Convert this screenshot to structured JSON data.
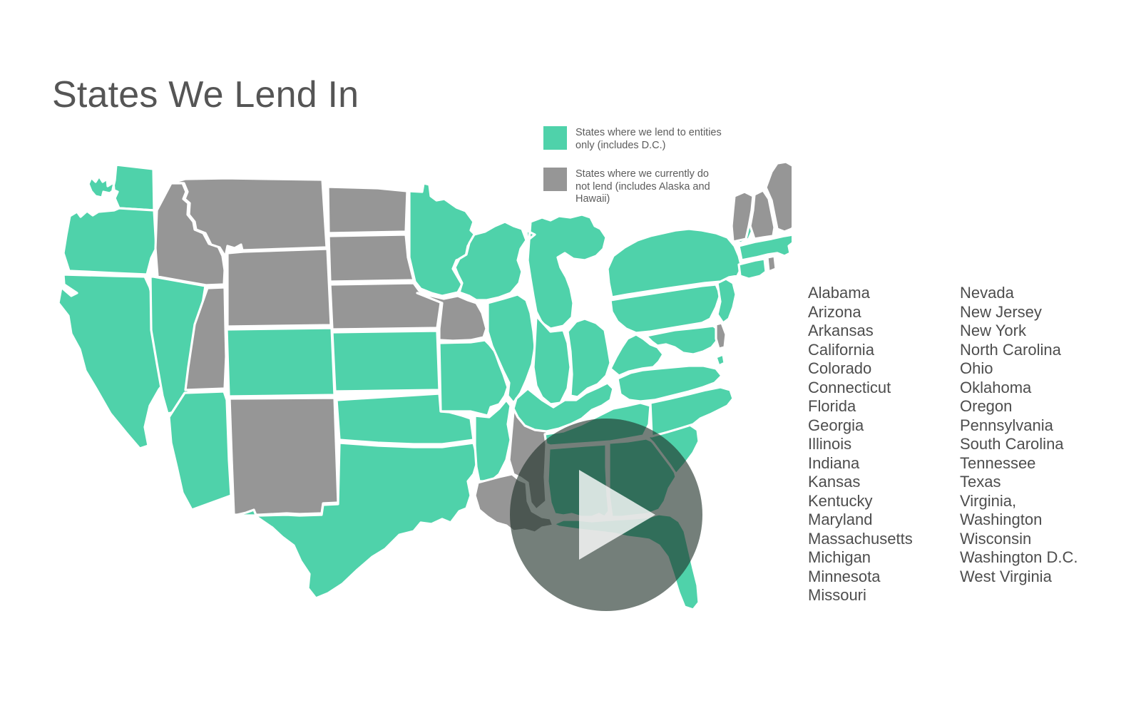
{
  "page": {
    "title": "States We Lend In",
    "background_color": "#ffffff",
    "text_color": "#4d4d4d"
  },
  "colors": {
    "lend_green": "#4FD2AA",
    "no_lend_gray": "#969696",
    "border_white": "#ffffff",
    "title_gray": "#555555",
    "overlay_dark": "rgba(30,48,40,0.62)",
    "overlay_triangle": "rgba(255,255,255,0.80)"
  },
  "legend": {
    "items": [
      {
        "swatch_color": "#4FD2AA",
        "label": "States where we lend to entities only (includes D.C.)",
        "icon": "green-square-swatch"
      },
      {
        "swatch_color": "#969696",
        "label": "States where we currently do not lend (includes Alaska and Hawaii)",
        "icon": "gray-square-swatch"
      }
    ]
  },
  "video": {
    "play_icon": "play-triangle-icon",
    "label": "Play video"
  },
  "state_list": {
    "column_1": [
      "Alabama",
      "Arizona",
      "Arkansas",
      "California",
      "Colorado",
      "Connecticut",
      "Florida",
      "Georgia",
      "Illinois",
      "Indiana",
      "Kansas",
      "Kentucky",
      "Maryland",
      "Massachusetts",
      "Michigan",
      "Minnesota",
      "Missouri"
    ],
    "column_2": [
      "Nevada",
      "New Jersey",
      "New York",
      "North Carolina",
      "Ohio",
      "Oklahoma",
      "Oregon",
      "Pennsylvania",
      "South Carolina",
      "Tennessee",
      "Texas",
      "Virginia,",
      "Washington",
      "Wisconsin",
      "Washington D.C.",
      "West Virginia"
    ]
  },
  "map_data": {
    "type": "choropleth",
    "region": "United States (contiguous)",
    "categories": {
      "lend": "States where we lend to entities only (includes D.C.)",
      "no_lend": "States where we currently do not lend (includes Alaska and Hawaii)"
    },
    "states": {
      "WA": "lend",
      "OR": "lend",
      "CA": "lend",
      "NV": "lend",
      "AZ": "lend",
      "ID": "no_lend",
      "MT": "no_lend",
      "WY": "no_lend",
      "UT": "no_lend",
      "CO": "lend",
      "NM": "no_lend",
      "ND": "no_lend",
      "SD": "no_lend",
      "NE": "no_lend",
      "KS": "lend",
      "OK": "lend",
      "TX": "lend",
      "MN": "lend",
      "IA": "no_lend",
      "MO": "lend",
      "AR": "lend",
      "LA": "no_lend",
      "WI": "lend",
      "IL": "lend",
      "MI": "lend",
      "IN": "lend",
      "OH": "lend",
      "KY": "lend",
      "TN": "lend",
      "MS": "no_lend",
      "AL": "lend",
      "GA": "lend",
      "FL": "lend",
      "SC": "lend",
      "NC": "lend",
      "VA": "lend",
      "WV": "lend",
      "MD": "lend",
      "DE": "no_lend",
      "PA": "lend",
      "NJ": "lend",
      "NY": "lend",
      "CT": "lend",
      "RI": "no_lend",
      "MA": "lend",
      "VT": "no_lend",
      "NH": "no_lend",
      "ME": "no_lend",
      "AK": "no_lend",
      "HI": "no_lend"
    }
  }
}
